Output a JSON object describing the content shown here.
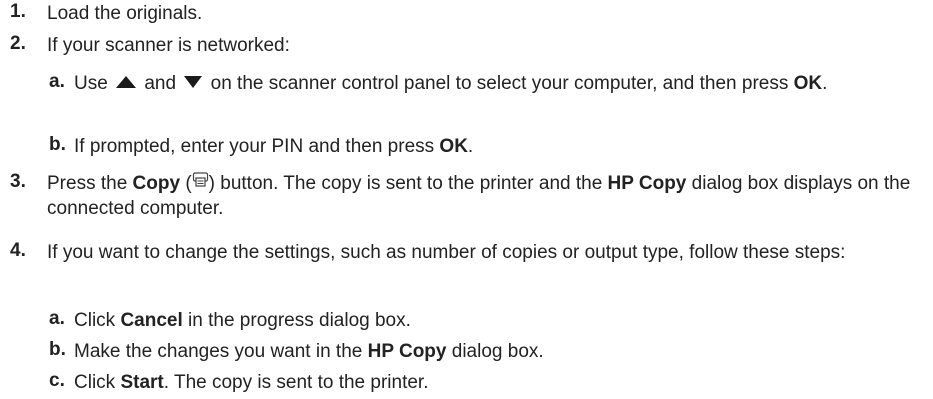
{
  "steps": [
    {
      "num": "1.",
      "text": "Load the originals."
    },
    {
      "num": "2.",
      "text": "If your scanner is networked:"
    },
    {
      "num": "3.",
      "pre": "Press the ",
      "b1": "Copy",
      "mid1": " (",
      "mid2": ") button. The copy is sent to the printer and the ",
      "b2": "HP Copy",
      "post": " dialog box displays on the connected computer."
    },
    {
      "num": "4.",
      "text": "If you want to change the settings, such as number of copies or output type, follow these steps:"
    }
  ],
  "step2_sub": [
    {
      "letter": "a.",
      "pre": "Use ",
      "mid": " and ",
      "post": " on the scanner control panel to select your computer, and then press ",
      "bold": "OK",
      "end": "."
    },
    {
      "letter": "b.",
      "pre": "If prompted, enter your PIN and then press ",
      "bold": "OK",
      "end": "."
    }
  ],
  "step4_sub": [
    {
      "letter": "a.",
      "pre": "Click ",
      "bold": "Cancel",
      "post": " in the progress dialog box."
    },
    {
      "letter": "b.",
      "pre": "Make the changes you want in the ",
      "bold": "HP Copy",
      "post": " dialog box."
    },
    {
      "letter": "c.",
      "pre": "Click ",
      "bold": "Start",
      "post": ". The copy is sent to the printer."
    }
  ],
  "icons": {
    "up": "up-arrow-icon",
    "down": "down-arrow-icon",
    "copy": "copy-button-icon"
  }
}
